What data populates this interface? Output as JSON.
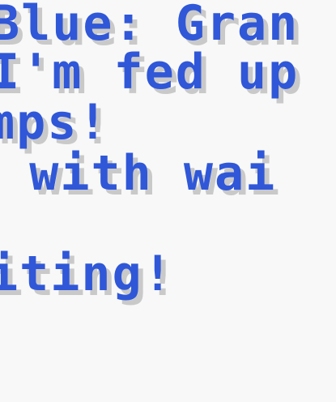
{
  "dialog": {
    "lines": [
      "Blue: Gran",
      "I'm fed up",
      "mps!",
      "p with wai",
      "iting!"
    ],
    "colors": {
      "text": "#2f57d8",
      "shadow": "#c9c9c9",
      "background": "#f8f8f8"
    }
  }
}
